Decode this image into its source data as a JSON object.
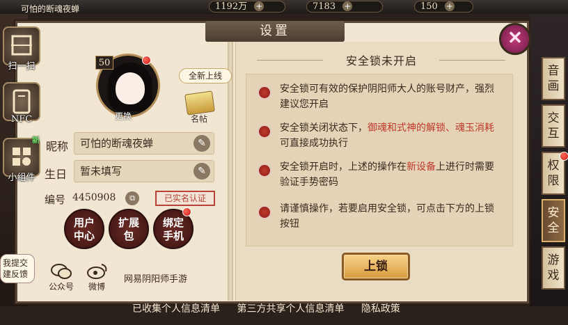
{
  "topbar": {
    "player_name": "可怕的断魂夜蝉",
    "resources": [
      {
        "name": "coin",
        "value": "1192万"
      },
      {
        "name": "jade",
        "value": "7183"
      },
      {
        "name": "stamina",
        "value": "150"
      }
    ],
    "plus": "+"
  },
  "dialog": {
    "title": "设置",
    "close_icon": "close-icon"
  },
  "side_tools": [
    {
      "label": "扫一扫",
      "icon": "scan-icon"
    },
    {
      "label": "NFC",
      "icon": "nfc-icon"
    },
    {
      "label": "小组件",
      "icon": "widget-icon",
      "tag": "新"
    }
  ],
  "profile": {
    "level": "50",
    "change_label": "更换",
    "new_online": "全新上线",
    "card_label": "名帖",
    "nickname_label": "昵称",
    "nickname_value": "可怕的断魂夜蝉",
    "birthday_label": "生日",
    "birthday_value": "暂未填写",
    "id_label": "编号",
    "id_value": "4450908",
    "verify_label": "已实名认证"
  },
  "round_buttons": [
    {
      "line1": "用户",
      "line2": "中心"
    },
    {
      "line1": "扩展",
      "line2": "包"
    },
    {
      "line1": "绑定",
      "line2": "手机"
    }
  ],
  "social": {
    "wechat_label": "公众号",
    "weibo_label": "微博",
    "studio_label": "网易阴阳师手游"
  },
  "feedback": {
    "line1": "我提交",
    "line2": "建反馈"
  },
  "security": {
    "title": "安全锁未开启",
    "items": [
      {
        "text": "安全锁可有效的保护阴阳师大人的账号财产，强烈建议您开启"
      },
      {
        "before": "安全锁关闭状态下，",
        "highlight": "御魂和式神的解锁、魂玉消耗",
        "after": "可直接成功执行"
      },
      {
        "before": "安全锁开启时，上述的操作在",
        "highlight": "新设备",
        "after": "上进行时需要验证手势密码"
      },
      {
        "text": "请谨慎操作，若要启用安全锁，可点击下方的上锁按钮"
      }
    ],
    "lock_button": "上锁",
    "highlight_color": "#c0392b"
  },
  "tabs": [
    {
      "label_top": "音",
      "label_bottom": "画"
    },
    {
      "label_top": "交",
      "label_bottom": "互"
    },
    {
      "label_top": "权",
      "label_bottom": "限"
    },
    {
      "label_top": "安",
      "label_bottom": "全"
    },
    {
      "label_top": "游",
      "label_bottom": "戏"
    }
  ],
  "active_tab": "安全",
  "bottom_links": [
    "已收集个人信息清单",
    "第三方共享个人信息清单",
    "隐私政策"
  ]
}
